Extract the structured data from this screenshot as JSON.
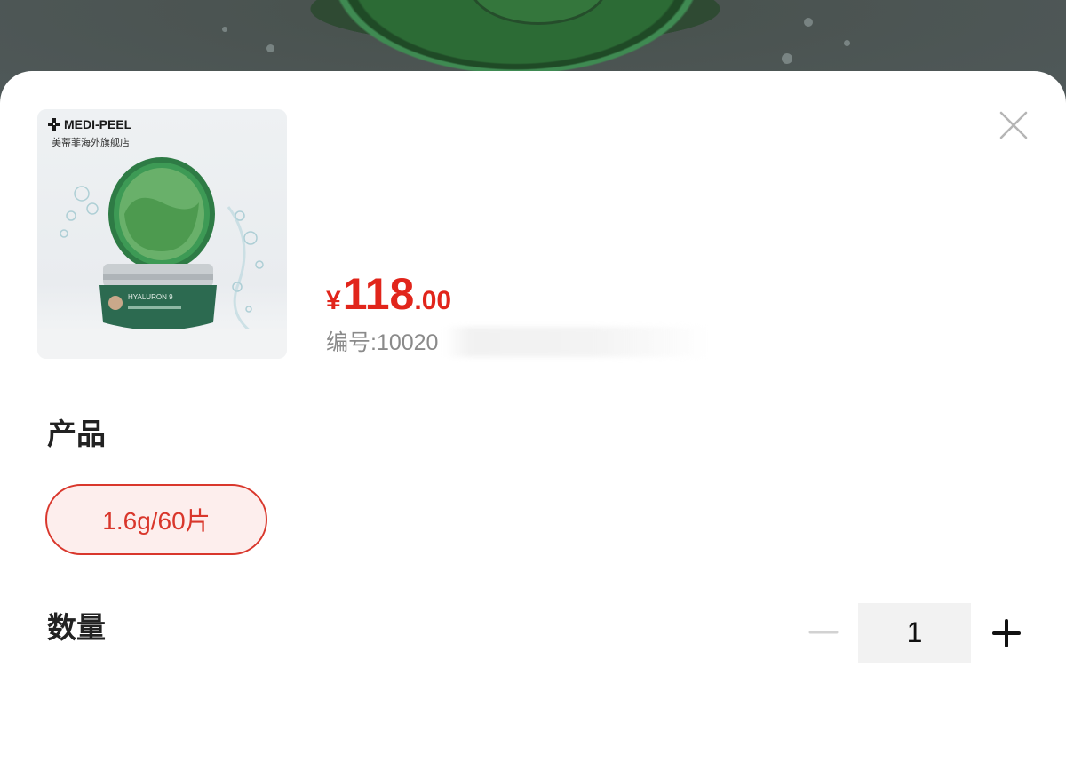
{
  "product": {
    "brand": "MEDI-PEEL",
    "store": "美蒂菲海外旗舰店",
    "package_text": "HYALURON 9",
    "price_currency": "¥",
    "price_integer": "118",
    "price_decimal": ".00",
    "sku_label": "编号:10020"
  },
  "sections": {
    "spec_title": "产品",
    "quantity_title": "数量"
  },
  "spec_options": [
    {
      "label": "1.6g/60片",
      "selected": true
    }
  ],
  "quantity": {
    "value": "1"
  },
  "colors": {
    "accent": "#e1251b",
    "chip_bg": "#fdeeed"
  },
  "icons": {
    "close": "close-icon",
    "minus": "minus-icon",
    "plus": "plus-icon"
  }
}
